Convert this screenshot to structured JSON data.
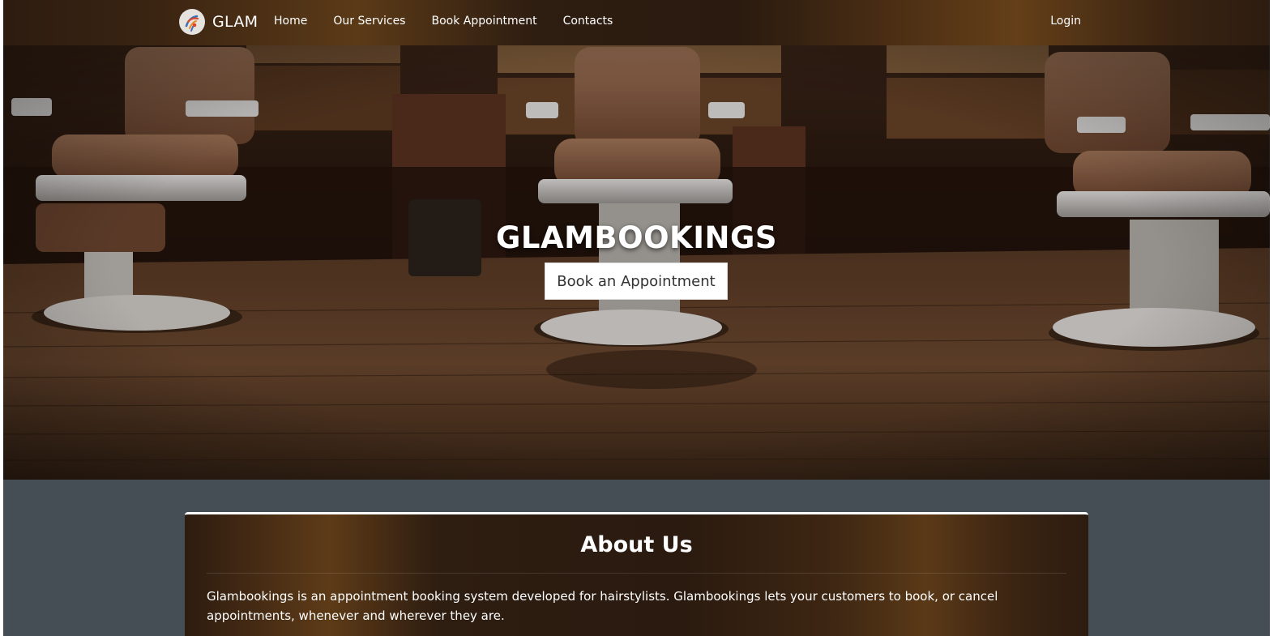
{
  "navbar": {
    "brand": "GLAM",
    "links": [
      {
        "label": "Home"
      },
      {
        "label": "Our Services"
      },
      {
        "label": "Book Appointment"
      },
      {
        "label": "Contacts"
      }
    ],
    "login": "Login"
  },
  "hero": {
    "title": "GLAMBOOKINGS",
    "button": "Book an Appointment"
  },
  "about": {
    "title": "About Us",
    "text": "Glambookings is an appointment booking system developed for hairstylists. Glambookings lets your customers to book, or cancel appointments, whenever and wherever they are."
  },
  "colors": {
    "page_bg": "#454d55",
    "nav_dark": "#2d1c10",
    "nav_accent": "#643f18",
    "button_bg": "#ffffff",
    "text_light": "#ffffff"
  },
  "icons": {
    "logo": "stylist-logo-icon"
  }
}
